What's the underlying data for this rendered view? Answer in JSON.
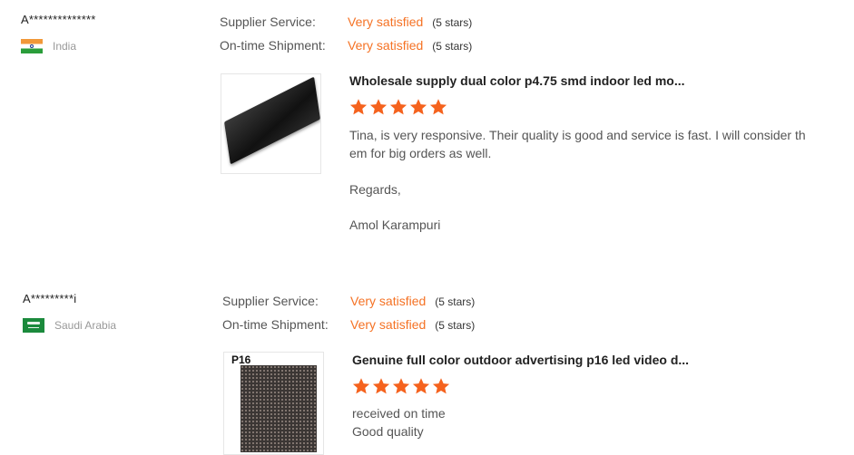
{
  "reviews": [
    {
      "buyer": "A**************",
      "country": "India",
      "supplier_service": {
        "label": "Supplier Service:",
        "value": "Very satisfied",
        "stars_text": "(5 stars)"
      },
      "on_time_shipment": {
        "label": "On-time Shipment:",
        "value": "Very satisfied",
        "stars_text": "(5 stars)"
      },
      "product_title": "Wholesale supply dual color p4.75 smd indoor led mo...",
      "rating": 5,
      "text_lines": [
        "Tina, is very responsive. Their quality is good and service is fast. I will consider th",
        "em for big orders as well.",
        "Regards,",
        "Amol Karampuri"
      ]
    },
    {
      "buyer": "A*********i",
      "country": "Saudi Arabia",
      "supplier_service": {
        "label": "Supplier Service:",
        "value": "Very satisfied",
        "stars_text": "(5 stars)"
      },
      "on_time_shipment": {
        "label": "On-time Shipment:",
        "value": "Very satisfied",
        "stars_text": "(5 stars)"
      },
      "product_image_label": "P16",
      "product_title": "Genuine full color outdoor advertising p16 led video d...",
      "rating": 5,
      "text_lines": [
        "received on time",
        "Good quality"
      ]
    }
  ],
  "colors": {
    "accent": "#f57224",
    "star": "#f5621d"
  },
  "icons": {
    "star": "star-icon",
    "flag_india": "india-flag-icon",
    "flag_saudi": "saudi-arabia-flag-icon"
  }
}
